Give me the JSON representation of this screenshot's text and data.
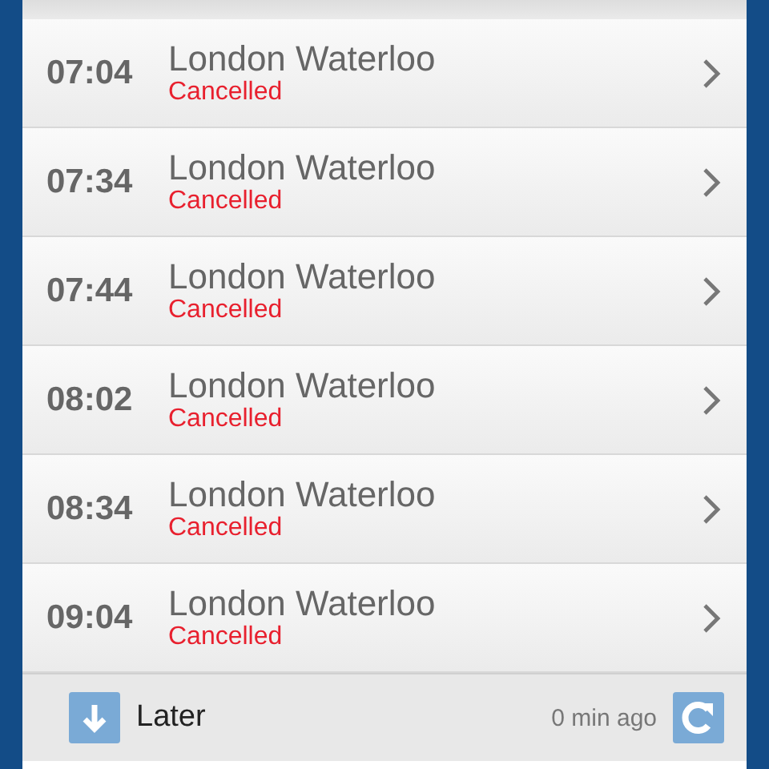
{
  "departures": [
    {
      "time": "07:04",
      "destination": "London Waterloo",
      "status": "Cancelled"
    },
    {
      "time": "07:34",
      "destination": "London Waterloo",
      "status": "Cancelled"
    },
    {
      "time": "07:44",
      "destination": "London Waterloo",
      "status": "Cancelled"
    },
    {
      "time": "08:02",
      "destination": "London Waterloo",
      "status": "Cancelled"
    },
    {
      "time": "08:34",
      "destination": "London Waterloo",
      "status": "Cancelled"
    },
    {
      "time": "09:04",
      "destination": "London Waterloo",
      "status": "Cancelled"
    }
  ],
  "footer": {
    "later_label": "Later",
    "updated": "0 min ago"
  }
}
